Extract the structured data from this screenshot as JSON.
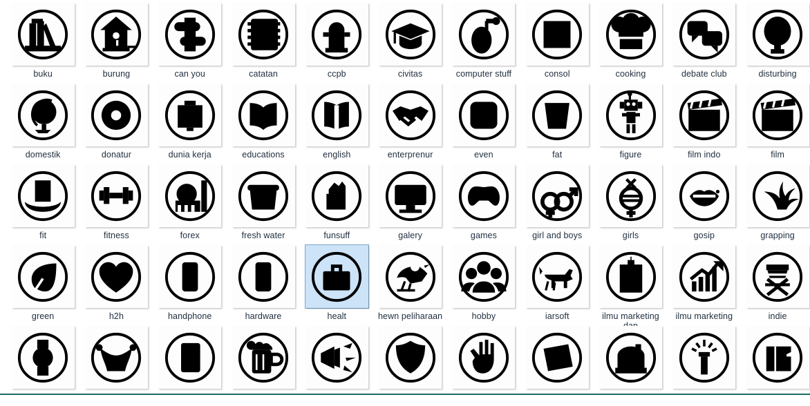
{
  "window": {
    "background_color": "#ffffff",
    "bottom_rule_color": "#1d6b63",
    "label_color": "#1f2d3d",
    "tile_color": "#fdfdfd",
    "selection_fill": "#cce3f8",
    "selection_border": "#7aa7c9"
  },
  "grid": {
    "columns": 11,
    "rows": 5,
    "selected_label": "healt",
    "items": [
      {
        "label": "buku",
        "icon": "books-icon",
        "glyph": "books"
      },
      {
        "label": "burung",
        "icon": "birdhouse-icon",
        "glyph": "birdhouse"
      },
      {
        "label": "can you",
        "icon": "puzzle-piece-icon",
        "glyph": "puzzle"
      },
      {
        "label": "catatan",
        "icon": "notebook-icon",
        "glyph": "notebook"
      },
      {
        "label": "ccpb",
        "icon": "hydrant-icon",
        "glyph": "hydrant"
      },
      {
        "label": "civitas",
        "icon": "graduation-cap-icon",
        "glyph": "gradcap"
      },
      {
        "label": "computer stuff",
        "icon": "mouse-icon",
        "glyph": "mouse"
      },
      {
        "label": "consol",
        "icon": "square-icon",
        "glyph": "square"
      },
      {
        "label": "cooking",
        "icon": "chef-hat-icon",
        "glyph": "chefhat"
      },
      {
        "label": "debate club",
        "icon": "speech-bubbles-icon",
        "glyph": "bubbles"
      },
      {
        "label": "disturbing",
        "icon": "balloon-icon",
        "glyph": "balloon"
      },
      {
        "label": "domestik",
        "icon": "globe-icon",
        "glyph": "globe"
      },
      {
        "label": "donatur",
        "icon": "donut-icon",
        "glyph": "donut"
      },
      {
        "label": "dunia kerja",
        "icon": "briefcase-flat-icon",
        "glyph": "case2"
      },
      {
        "label": "educations",
        "icon": "open-book-icon",
        "glyph": "openbook"
      },
      {
        "label": "english",
        "icon": "book-icon",
        "glyph": "book"
      },
      {
        "label": "enterprenur",
        "icon": "handshake-icon",
        "glyph": "handshake"
      },
      {
        "label": "even",
        "icon": "rounded-square-icon",
        "glyph": "rsquare"
      },
      {
        "label": "fat",
        "icon": "bucket-icon",
        "glyph": "bucket"
      },
      {
        "label": "figure",
        "icon": "robot-icon",
        "glyph": "robot"
      },
      {
        "label": "film indo",
        "icon": "clapperboard-icon",
        "glyph": "clapper"
      },
      {
        "label": "film",
        "icon": "clapperboard-icon",
        "glyph": "clapper"
      },
      {
        "label": "fit",
        "icon": "top-hat-icon",
        "glyph": "tophat"
      },
      {
        "label": "fitness",
        "icon": "dumbbell-icon",
        "glyph": "dumbbell"
      },
      {
        "label": "forex",
        "icon": "factory-icon",
        "glyph": "factory"
      },
      {
        "label": "fresh water",
        "icon": "pot-icon",
        "glyph": "pot"
      },
      {
        "label": "funsuff",
        "icon": "fist-icon",
        "glyph": "fist"
      },
      {
        "label": "galery",
        "icon": "monitor-icon",
        "glyph": "monitor"
      },
      {
        "label": "games",
        "icon": "gamepad-icon",
        "glyph": "gamepad"
      },
      {
        "label": "girl and boys",
        "icon": "gender-symbols-icon",
        "glyph": "gender"
      },
      {
        "label": "girls",
        "icon": "female-symbol-icon",
        "glyph": "female"
      },
      {
        "label": "gosip",
        "icon": "lips-icon",
        "glyph": "lips"
      },
      {
        "label": "grapping",
        "icon": "splash-icon",
        "glyph": "splash"
      },
      {
        "label": "green",
        "icon": "leaf-icon",
        "glyph": "leaf"
      },
      {
        "label": "h2h",
        "icon": "heart-icon",
        "glyph": "heart"
      },
      {
        "label": "handphone",
        "icon": "phone-icon",
        "glyph": "phone"
      },
      {
        "label": "hardware",
        "icon": "phone-icon",
        "glyph": "phone"
      },
      {
        "label": "healt",
        "icon": "briefcase-icon",
        "glyph": "briefcase"
      },
      {
        "label": "hewn peliharaan",
        "icon": "bird-icon",
        "glyph": "bird"
      },
      {
        "label": "hobby",
        "icon": "group-people-icon",
        "glyph": "people"
      },
      {
        "label": "iarsoft",
        "icon": "dog-icon",
        "glyph": "dog"
      },
      {
        "label": "ilmu marketing dan",
        "icon": "clipboard-icon",
        "glyph": "clipboard"
      },
      {
        "label": "ilmu marketing",
        "icon": "growth-chart-icon",
        "glyph": "growth"
      },
      {
        "label": "indie",
        "icon": "director-chair-icon",
        "glyph": "chair"
      },
      {
        "label": "",
        "icon": "watch-icon",
        "glyph": "watch"
      },
      {
        "label": "",
        "icon": "jester-hat-icon",
        "glyph": "jester"
      },
      {
        "label": "",
        "icon": "card-icon",
        "glyph": "card"
      },
      {
        "label": "",
        "icon": "beer-mug-icon",
        "glyph": "beer"
      },
      {
        "label": "",
        "icon": "megaphone-icon",
        "glyph": "megaphone"
      },
      {
        "label": "",
        "icon": "shield-icon",
        "glyph": "shield"
      },
      {
        "label": "",
        "icon": "hand-icon",
        "glyph": "hand"
      },
      {
        "label": "",
        "icon": "paper-sheet-icon",
        "glyph": "sheet"
      },
      {
        "label": "",
        "icon": "bag-icon",
        "glyph": "bag"
      },
      {
        "label": "",
        "icon": "flashlight-icon",
        "glyph": "flashlight"
      },
      {
        "label": "",
        "icon": "book-stack-icon",
        "glyph": "bookstack"
      }
    ]
  }
}
